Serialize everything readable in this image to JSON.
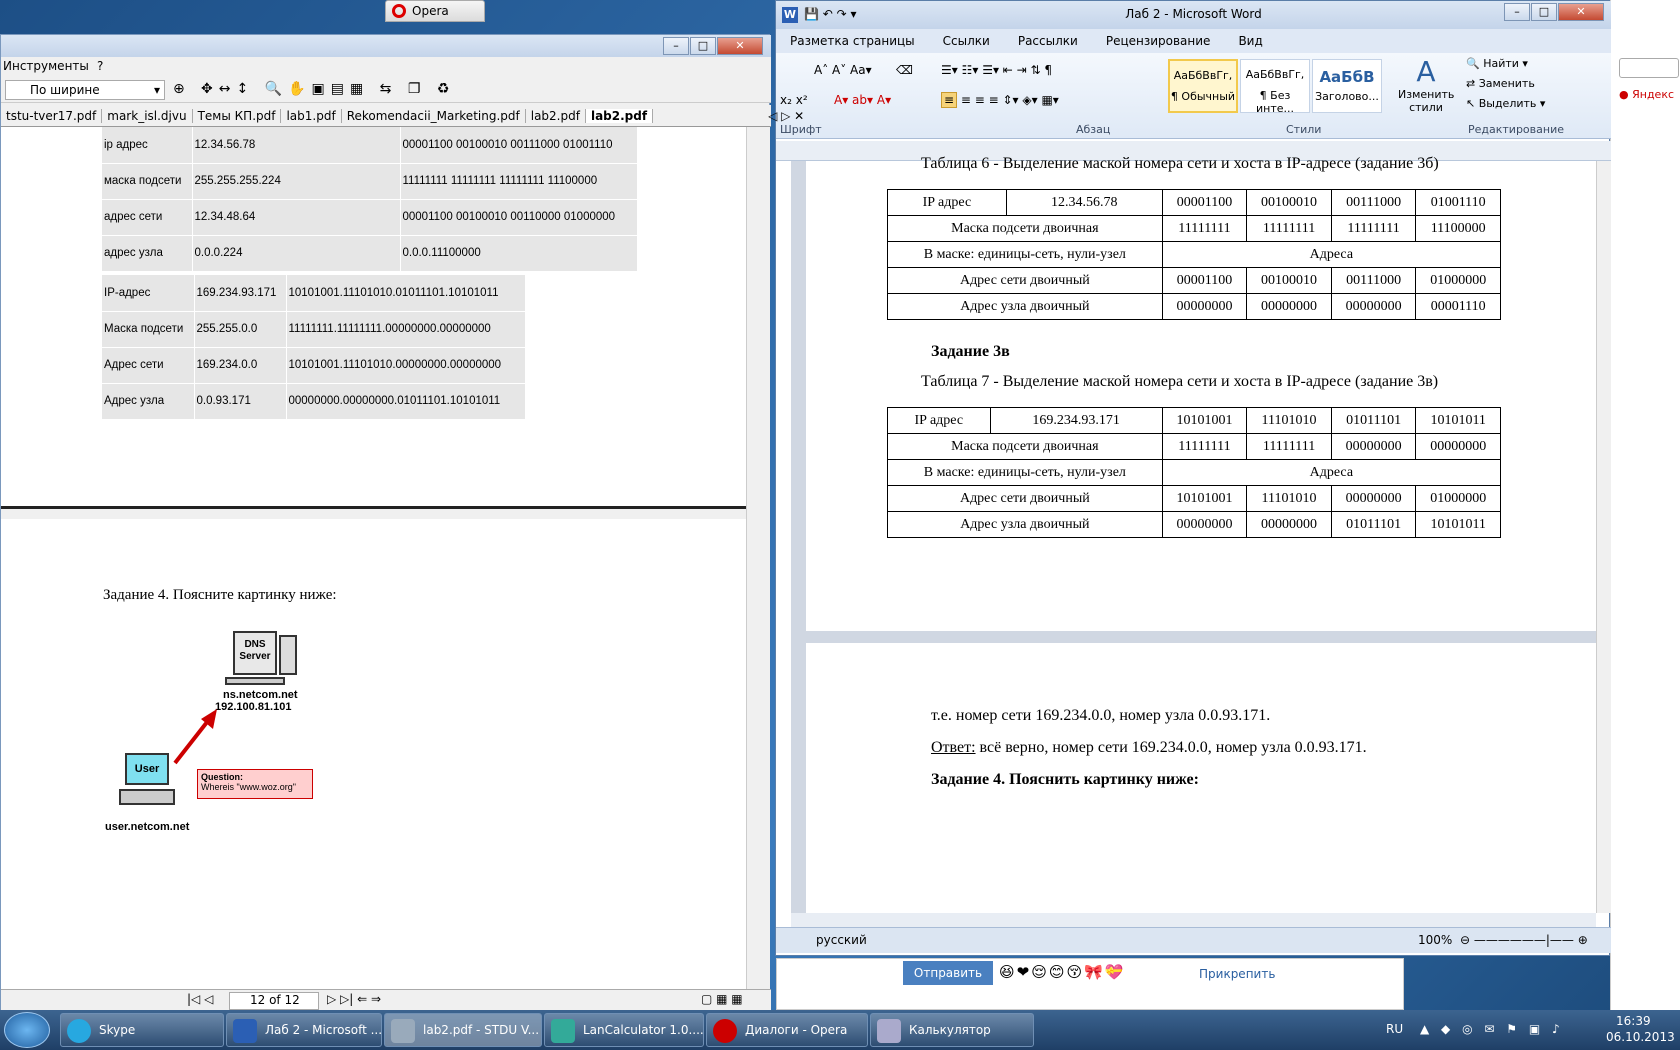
{
  "word": {
    "title": "Лаб 2 - Microsoft Word",
    "tabs": [
      "Разметка страницы",
      "Ссылки",
      "Рассылки",
      "Рецензирование",
      "Вид"
    ],
    "groups": {
      "font": "Шрифт",
      "paragraph": "Абзац",
      "styles": "Стили",
      "editing": "Редактирование"
    },
    "styles": [
      {
        "sample": "АаБбВвГг,",
        "name": "¶ Обычный"
      },
      {
        "sample": "АаБбВвГг,",
        "name": "¶ Без инте..."
      },
      {
        "sample": "АаБбВ",
        "name": "Заголово..."
      }
    ],
    "change_styles": "Изменить стили",
    "find": "Найти",
    "replace": "Заменить",
    "select": "Выделить",
    "table6_caption": "Таблица 6 - Выделение маской номера сети и хоста в IP-адресе (задание 3б)",
    "table6": [
      [
        "IP адрес",
        "12.34.56.78",
        "00001100",
        "00100010",
        "00111000",
        "01001110"
      ],
      [
        "Маска подсети двоичная",
        "",
        "11111111",
        "11111111",
        "11111111",
        "11100000"
      ],
      [
        "В маске: единицы-сеть, нули-узел",
        "",
        "Адреса"
      ],
      [
        "Адрес сети двоичный",
        "",
        "00001100",
        "00100010",
        "00111000",
        "01000000"
      ],
      [
        "Адрес узла двоичный",
        "",
        "00000000",
        "00000000",
        "00000000",
        "00001110"
      ]
    ],
    "task3v": "Задание 3в",
    "table7_caption": "Таблица 7 - Выделение маской номера сети и хоста в IP-адресе (задание 3в)",
    "table7": [
      [
        "IP адрес",
        "169.234.93.171",
        "10101001",
        "11101010",
        "01011101",
        "10101011"
      ],
      [
        "Маска подсети двоичная",
        "",
        "11111111",
        "11111111",
        "00000000",
        "00000000"
      ],
      [
        "В маске: единицы-сеть, нули-узел",
        "",
        "Адреса"
      ],
      [
        "Адрес сети двоичный",
        "",
        "10101001",
        "11101010",
        "00000000",
        "01000000"
      ],
      [
        "Адрес узла двоичный",
        "",
        "00000000",
        "00000000",
        "01011101",
        "10101011"
      ]
    ],
    "line1": "т.е. номер сети 169.234.0.0, номер узла 0.0.93.171.",
    "answer_label": "Ответ:",
    "answer": " всё верно, номер сети 169.234.0.0, номер узла 0.0.93.171.",
    "task4": "Задание 4. Пояснить картинку ниже:",
    "lang": "русский",
    "zoom": "100%"
  },
  "opera": {
    "tab": "Opera",
    "yandex": "Яндекс"
  },
  "stdu": {
    "menu_tools": "Инструменты",
    "menu_help": "?",
    "fit": "По ширине",
    "tabs": [
      "tstu-tver17.pdf",
      "mark_isl.djvu",
      "Темы КП.pdf",
      "lab1.pdf",
      "Rekomendacii_Marketing.pdf",
      "lab2.pdf",
      "lab2.pdf"
    ],
    "rows1": [
      [
        "ip адрес",
        "12.34.56.78",
        "00001100 00100010 00111000 01001110"
      ],
      [
        "маска подсети",
        "255.255.255.224",
        "11111111 11111111 11111111 11100000"
      ],
      [
        "адрес сети",
        "12.34.48.64",
        "00001100 00100010 00110000 01000000"
      ],
      [
        "адрес узла",
        "0.0.0.224",
        "0.0.0.11100000"
      ]
    ],
    "rows2": [
      [
        "IP-адрес",
        "169.234.93.171",
        "10101001.11101010.01011101.10101011"
      ],
      [
        "Маска подсети",
        "255.255.0.0",
        "11111111.11111111.00000000.00000000"
      ],
      [
        "Адрес сети",
        "169.234.0.0",
        "10101001.11101010.00000000.00000000"
      ],
      [
        "Адрес узла",
        "0.0.93.171",
        "00000000.00000000.01011101.10101011"
      ]
    ],
    "task4": "Задание 4. Поясните картинку ниже:",
    "dns_label": "DNS Server",
    "dns_host": "ns.netcom.net",
    "dns_ip": "192.100.81.101",
    "user_label": "User",
    "user_host": "user.netcom.net",
    "question_title": "Question:",
    "question_text": "Whereis \"www.woz.org\"",
    "page_indicator": "12 of 12"
  },
  "chat": {
    "send": "Отправить",
    "attach": "Прикрепить"
  },
  "taskbar": {
    "items": [
      "Skype",
      "Лаб 2 - Microsoft ...",
      "lab2.pdf - STDU V...",
      "LanCalculator 1.0....",
      "Диалоги - Opera",
      "Калькулятор"
    ],
    "lang": "RU",
    "time": "16:39",
    "date": "06.10.2013"
  }
}
